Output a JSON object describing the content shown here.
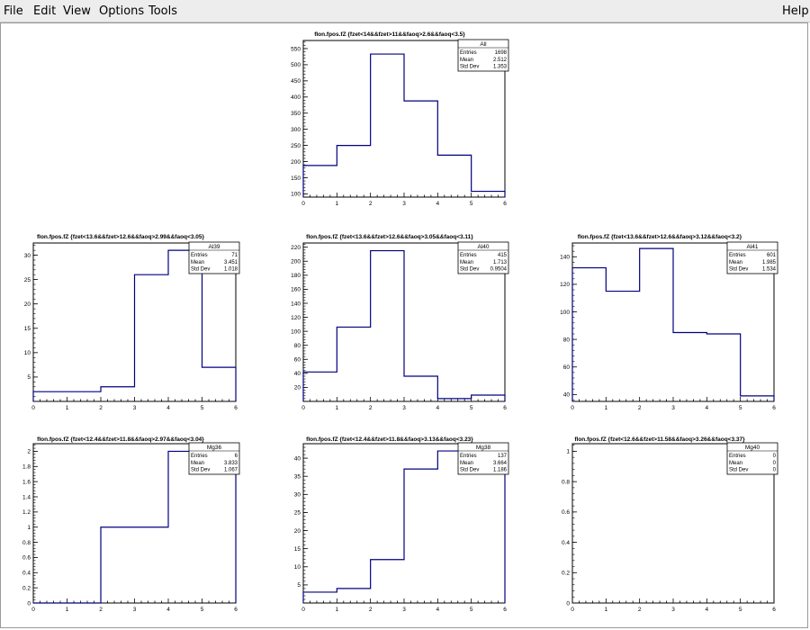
{
  "menu": {
    "file": "File",
    "edit": "Edit",
    "view": "View",
    "options": "Options",
    "tools": "Tools",
    "help": "Help"
  },
  "chart_data": [
    {
      "type": "bar",
      "title": "fIon.fpos.fZ {fzet<14&&fzet>11&&faoq>2.6&&faoq<3.5}",
      "stats": {
        "name": "All",
        "entries": "1698",
        "mean": "2.512",
        "std_dev": "1.353"
      },
      "bin_edges": [
        0,
        1,
        2,
        3,
        4,
        5,
        6
      ],
      "values": [
        188,
        250,
        533,
        388,
        220,
        108
      ],
      "xlim": [
        0,
        6
      ],
      "ylim": [
        90,
        575
      ],
      "xticks": [
        "0",
        "1",
        "2",
        "3",
        "4",
        "5",
        "6"
      ],
      "yticks": [
        "100",
        "150",
        "200",
        "250",
        "300",
        "350",
        "400",
        "450",
        "500",
        "550"
      ],
      "color": "#000080"
    },
    {
      "type": "bar",
      "title": "fIon.fpos.fZ {fzet<13.6&&fzet>12.6&&faoq>2.99&&faoq<3.05}",
      "stats": {
        "name": "Al39",
        "entries": "71",
        "mean": "3.451",
        "std_dev": "1.018"
      },
      "bin_edges": [
        0,
        1,
        2,
        3,
        4,
        5,
        6
      ],
      "values": [
        2,
        2,
        3,
        26,
        31,
        7
      ],
      "xlim": [
        0,
        6
      ],
      "ylim": [
        0,
        32.5
      ],
      "xticks": [
        "0",
        "1",
        "2",
        "3",
        "4",
        "5",
        "6"
      ],
      "yticks": [
        "5",
        "10",
        "15",
        "20",
        "25",
        "30"
      ],
      "color": "#000080"
    },
    {
      "type": "bar",
      "title": "fIon.fpos.fZ {fzet<13.6&&fzet>12.6&&faoq>3.05&&faoq<3.11}",
      "stats": {
        "name": "Al40",
        "entries": "415",
        "mean": "1.713",
        "std_dev": "0.9504"
      },
      "bin_edges": [
        0,
        1,
        2,
        3,
        4,
        5,
        6
      ],
      "values": [
        42,
        106,
        215,
        36,
        4,
        9
      ],
      "xlim": [
        0,
        6
      ],
      "ylim": [
        0,
        226
      ],
      "xticks": [
        "0",
        "1",
        "2",
        "3",
        "4",
        "5",
        "6"
      ],
      "yticks": [
        "20",
        "40",
        "60",
        "80",
        "100",
        "120",
        "140",
        "160",
        "180",
        "200",
        "220"
      ],
      "color": "#000080"
    },
    {
      "type": "bar",
      "title": "fIon.fpos.fZ {fzet<13.6&&fzet>12.6&&faoq>3.12&&faoq<3.2}",
      "stats": {
        "name": "Al41",
        "entries": "601",
        "mean": "1.985",
        "std_dev": "1.534"
      },
      "bin_edges": [
        0,
        1,
        2,
        3,
        4,
        5,
        6
      ],
      "values": [
        132,
        115,
        146,
        85,
        84,
        39
      ],
      "xlim": [
        0,
        6
      ],
      "ylim": [
        35,
        150
      ],
      "xticks": [
        "0",
        "1",
        "2",
        "3",
        "4",
        "5",
        "6"
      ],
      "yticks": [
        "40",
        "60",
        "80",
        "100",
        "120",
        "140"
      ],
      "color": "#000080"
    },
    {
      "type": "bar",
      "title": "fIon.fpos.fZ {fzet<12.4&&fzet>11.8&&faoq>2.97&&faoq<3.04}",
      "stats": {
        "name": "Mg36",
        "entries": "6",
        "mean": "3.833",
        "std_dev": "1.067"
      },
      "bin_edges": [
        0,
        1,
        2,
        3,
        4,
        5,
        6
      ],
      "values": [
        0,
        0,
        1,
        1,
        2,
        2
      ],
      "xlim": [
        0,
        6
      ],
      "ylim": [
        0,
        2.1
      ],
      "xticks": [
        "0",
        "1",
        "2",
        "3",
        "4",
        "5",
        "6"
      ],
      "yticks": [
        "0",
        "0.2",
        "0.4",
        "0.6",
        "0.8",
        "1",
        "1.2",
        "1.4",
        "1.6",
        "1.8",
        "2"
      ],
      "color": "#000080"
    },
    {
      "type": "bar",
      "title": "fIon.fpos.fZ {fzet<12.4&&fzet>11.8&&faoq>3.13&&faoq<3.23}",
      "stats": {
        "name": "Mg38",
        "entries": "137",
        "mean": "3.664",
        "std_dev": "1.186"
      },
      "bin_edges": [
        0,
        1,
        2,
        3,
        4,
        5,
        6
      ],
      "values": [
        3,
        4,
        12,
        37,
        42,
        40
      ],
      "xlim": [
        0,
        6
      ],
      "ylim": [
        0,
        44
      ],
      "xticks": [
        "0",
        "1",
        "2",
        "3",
        "4",
        "5",
        "6"
      ],
      "yticks": [
        "5",
        "10",
        "15",
        "20",
        "25",
        "30",
        "35",
        "40"
      ],
      "color": "#000080"
    },
    {
      "type": "bar",
      "title": "fIon.fpos.fZ {fzet<12.6&&fzet>11.58&&faoq>3.26&&faoq<3.37}",
      "stats": {
        "name": "Mg40",
        "entries": "0",
        "mean": "0",
        "std_dev": "0"
      },
      "bin_edges": [
        0,
        1,
        2,
        3,
        4,
        5,
        6
      ],
      "values": [],
      "xlim": [
        0,
        6
      ],
      "ylim": [
        0,
        1.05
      ],
      "xticks": [
        "0",
        "1",
        "2",
        "3",
        "4",
        "5",
        "6"
      ],
      "yticks": [
        "0",
        "0.2",
        "0.4",
        "0.6",
        "0.8",
        "1"
      ],
      "color": "#000080"
    }
  ]
}
